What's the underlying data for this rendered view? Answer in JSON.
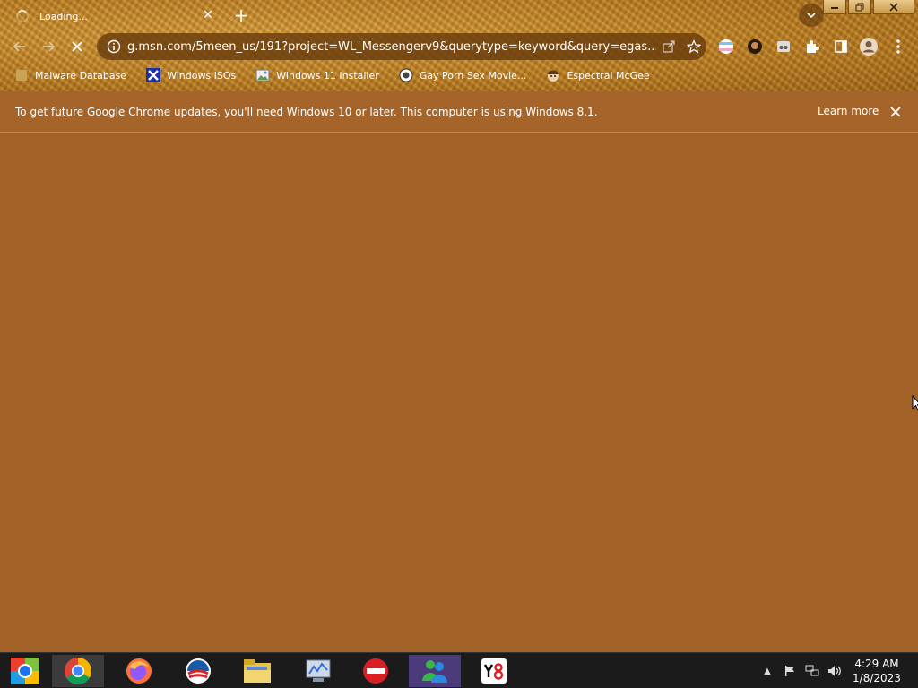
{
  "browser": {
    "tab": {
      "title": "Loading...",
      "icon": "loading-spinner-icon"
    },
    "toolbar": {
      "url": "g.msn.com/5meen_us/191?project=WL_Messengerv9&querytype=keyword&query=egas..."
    },
    "bookmarks": [
      {
        "label": "Malware Database",
        "icon": "bookmark-favicon-icon"
      },
      {
        "label": "Windows ISOs",
        "icon": "x-logo-icon"
      },
      {
        "label": "Windows 11 Installer",
        "icon": "image-icon"
      },
      {
        "label": "Gay Porn Sex Movie...",
        "icon": "favicon-icon"
      },
      {
        "label": "Espectral McGee",
        "icon": "cartoon-face-icon"
      }
    ],
    "infobar": {
      "message": "To get future Google Chrome updates, you'll need Windows 10 or later. This computer is using Windows 8.1.",
      "learn_more": "Learn more"
    }
  },
  "taskbar": {
    "apps": [
      {
        "name": "start-button"
      },
      {
        "name": "chrome"
      },
      {
        "name": "firefox"
      },
      {
        "name": "outlook"
      },
      {
        "name": "file-explorer"
      },
      {
        "name": "task-manager"
      },
      {
        "name": "no-entry-app"
      },
      {
        "name": "windows-live-messenger"
      },
      {
        "name": "y8-games"
      }
    ],
    "clock": {
      "time": "4:29 AM",
      "date": "1/8/2023"
    }
  },
  "colors": {
    "page_background": "#a26127",
    "infobar_background": "#a4642a",
    "taskbar_background": "#1b1b1b",
    "theme_gold": "#c48a31"
  }
}
